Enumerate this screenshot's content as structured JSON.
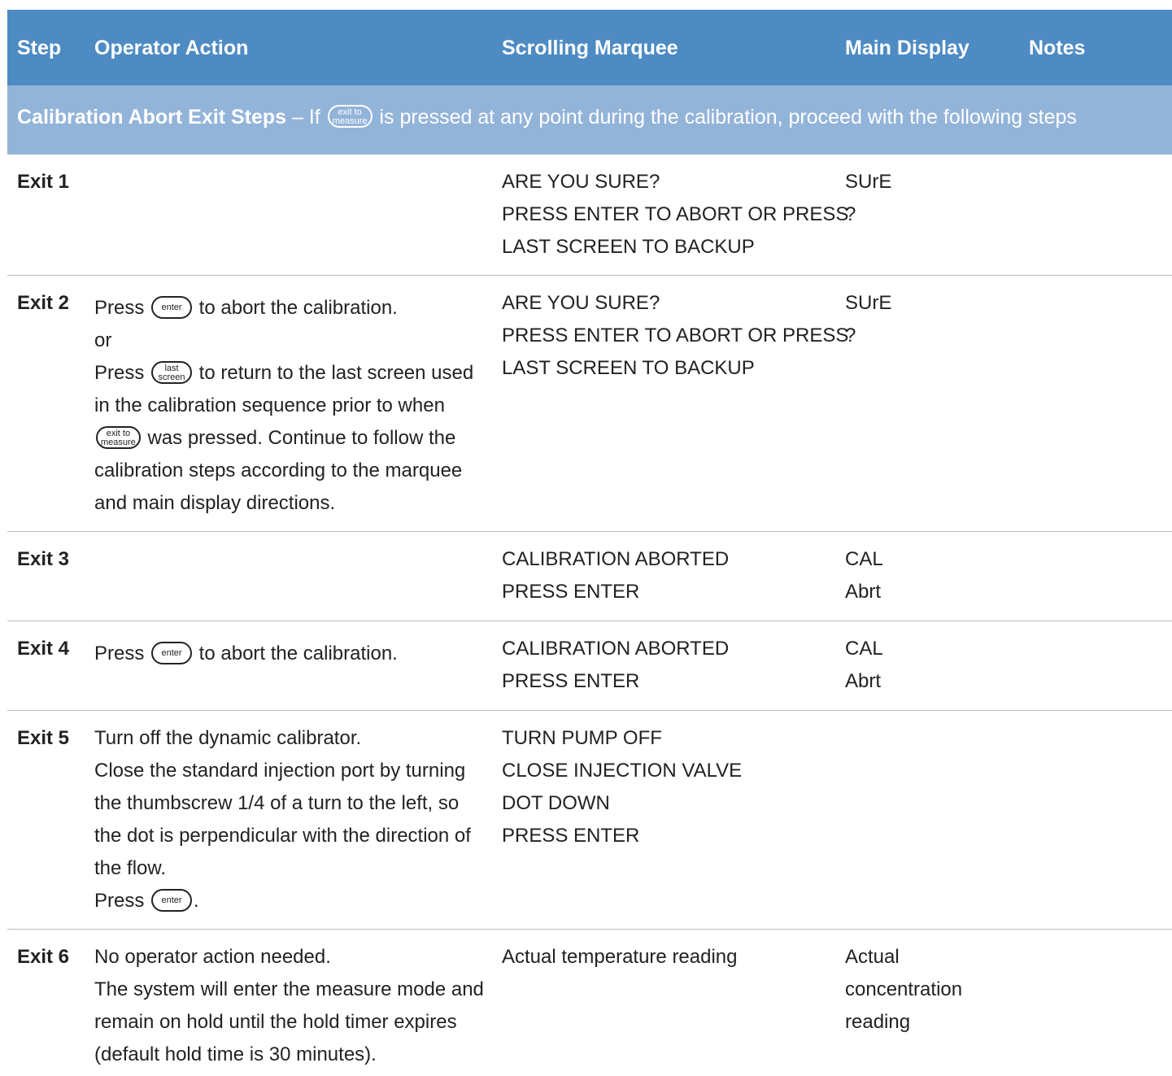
{
  "header": {
    "step": "Step",
    "operator_action": "Operator Action",
    "scrolling_marquee": "Scrolling Marquee",
    "main_display": "Main Display",
    "notes": "Notes"
  },
  "section": {
    "title": "Calibration Abort Exit Steps",
    "dash": " – If ",
    "rest": " is pressed at any point during the calibration, proceed with the following steps"
  },
  "keys": {
    "exit_l1": "exit to",
    "exit_l2": "measure",
    "enter": "enter",
    "last_l1": "last",
    "last_l2": "screen"
  },
  "rows": [
    {
      "step": "Exit 1",
      "marquee": [
        "ARE YOU SURE?",
        "PRESS ENTER TO ABORT OR PRESS",
        "LAST SCREEN TO BACKUP"
      ],
      "display": [
        "SUrE",
        "?"
      ]
    },
    {
      "step": "Exit 2",
      "action": {
        "a1_pre": "Press ",
        "a1_post": " to abort the calibration.",
        "or": "or",
        "a3_pre": "Press ",
        "a3_post": " to return to the last screen used",
        "a4": "in the calibration sequence prior to when",
        "a5_post": " was pressed. Continue to follow the",
        "a6": "calibration steps according to the marquee",
        "a7": "and main display directions."
      },
      "marquee": [
        "ARE YOU SURE?",
        "PRESS ENTER TO ABORT OR PRESS",
        "LAST SCREEN TO BACKUP"
      ],
      "display": [
        "SUrE",
        "?"
      ]
    },
    {
      "step": "Exit 3",
      "marquee": [
        "CALIBRATION ABORTED",
        "PRESS ENTER"
      ],
      "display": [
        "CAL",
        "Abrt"
      ]
    },
    {
      "step": "Exit 4",
      "action": {
        "a1_pre": "Press ",
        "a1_post": " to abort the calibration."
      },
      "marquee": [
        "CALIBRATION ABORTED",
        "PRESS ENTER"
      ],
      "display": [
        "CAL",
        "Abrt"
      ]
    },
    {
      "step": "Exit 5",
      "action": {
        "l1": "Turn off the dynamic calibrator.",
        "l2": "Close the standard injection port by turning",
        "l3": "the thumbscrew 1/4 of a turn to the left, so",
        "l4": "the dot is perpendicular with the direction of",
        "l5": "the flow.",
        "l6_pre": "Press ",
        "l6_post": "."
      },
      "marquee": [
        "TURN PUMP OFF",
        "CLOSE INJECTION VALVE",
        "DOT DOWN",
        "PRESS ENTER"
      ]
    },
    {
      "step": "Exit 6",
      "action": {
        "l1": "No operator action needed.",
        "l2": "The system will enter the measure mode and",
        "l3": "remain on hold until the hold timer expires",
        "l4": "(default hold time is 30 minutes)."
      },
      "marquee": [
        "Actual temperature reading"
      ],
      "display": [
        "Actual",
        "concentration",
        "reading"
      ]
    }
  ]
}
